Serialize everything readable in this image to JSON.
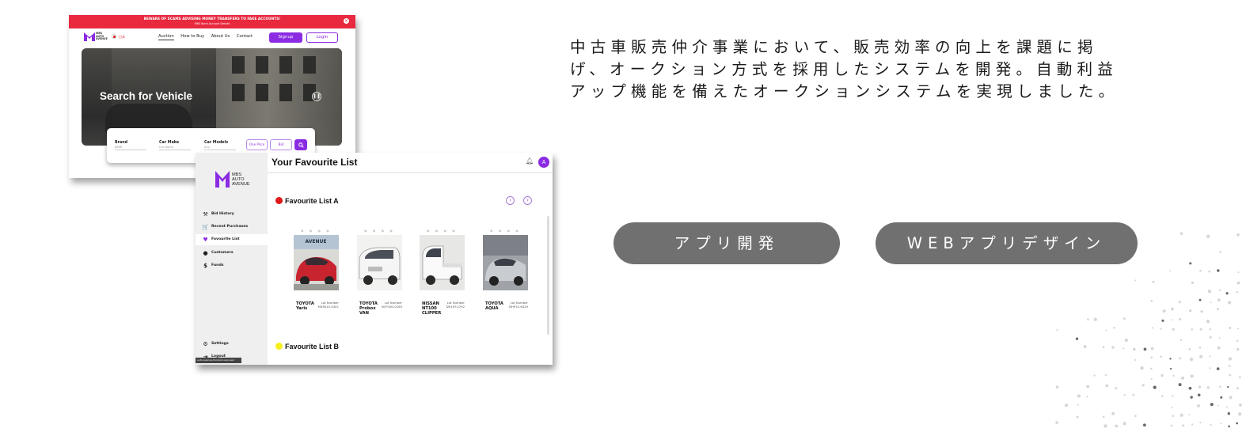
{
  "site": {
    "banner_warning": "BEWARE OF SCAMS ADVISING MONEY TRANSFERS TO FAKE ACCOUNTS!",
    "banner_sub": "MBS Bank Account Details",
    "logo_text": [
      "MBS",
      "AUTO",
      "AVENUE"
    ],
    "lang": "日本",
    "nav": [
      "Auction",
      "How to Buy",
      "About Us",
      "Contact"
    ],
    "signup": "Signup",
    "login": "Login",
    "hero_title": "Search for Vehicle",
    "search_fields": [
      {
        "label": "Brand",
        "placeholder": "BMW"
      },
      {
        "label": "Car Make",
        "placeholder": "Car Name"
      },
      {
        "label": "Car Models",
        "placeholder": "Any"
      }
    ],
    "btn_one_price": "One Price",
    "btn_bid": "Bid"
  },
  "dashboard": {
    "logo_text": [
      "MBS",
      "AUTO",
      "AVENUE"
    ],
    "title": "Your Favourite List",
    "avatar_initial": "A",
    "nav": [
      {
        "label": "Bid History",
        "icon": "gavel-icon"
      },
      {
        "label": "Recent Purchases",
        "icon": "cart-icon"
      },
      {
        "label": "Favourite List",
        "icon": "heart-icon",
        "active": true
      },
      {
        "label": "Customers",
        "icon": "person-icon"
      },
      {
        "label": "Funds",
        "icon": "dollar-icon"
      }
    ],
    "settings": "Settings",
    "logout": "Logout",
    "tooltip": "auto-avenue-frontend-app.web",
    "list_a": "Favourite List A",
    "list_b": "Favourite List B",
    "list_a_color": "#e01818",
    "list_b_color": "#f7ef1c",
    "cars": [
      {
        "name": "TOYOTA Yaris",
        "lot": "Lot Number ",
        "lot_no": "MXPA10-0401",
        "color": "#c8242f"
      },
      {
        "name": "TOYOTA Probox VAN",
        "lot": "Lot Number",
        "lot_no": "NCP160-0169",
        "color": "#eeeeee"
      },
      {
        "name": "NISSAN NT100 CLIPPER",
        "lot": "Lot Number",
        "lot_no": "DR16T-0792",
        "color": "#f4f4f4"
      },
      {
        "name": "TOYOTA AQUA",
        "lot": "Lot Number",
        "lot_no": "NHP10-6429",
        "color": "#b9bcc0"
      }
    ]
  },
  "description": [
    "中古車販売仲介事業において、販売効率の向上を課題に掲",
    "げ、オークション方式を採用したシステムを開発。自動利益",
    "アップ機能を備えたオークションシステムを実現しました。"
  ],
  "tags": [
    "アプリ開発",
    "WEBアプリデザイン"
  ],
  "colors": {
    "accent": "#8b2be2",
    "banner": "#e8293e",
    "pill": "#707070"
  }
}
